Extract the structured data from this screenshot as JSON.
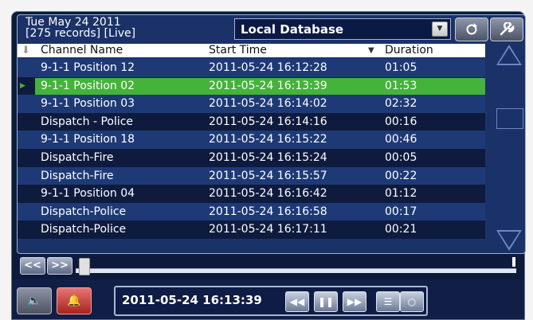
{
  "header": {
    "date": "Tue May 24 2011",
    "info": "[275 records]  [Live]"
  },
  "database": {
    "selected": "Local Database"
  },
  "toolbar": {
    "refresh_icon": "refresh-icon",
    "settings_icon": "wrench-icon"
  },
  "table": {
    "columns": [
      "Channel Name",
      "Start Time",
      "Duration"
    ],
    "rows": [
      {
        "channel": "9-1-1 Position 12",
        "start": "2011-05-24  16:12:28",
        "duration": "01:05"
      },
      {
        "channel": "9-1-1 Position 02",
        "start": "2011-05-24  16:13:39",
        "duration": "01:53"
      },
      {
        "channel": "9-1-1 Position 03",
        "start": "2011-05-24  16:14:02",
        "duration": "02:32"
      },
      {
        "channel": "Dispatch - Police",
        "start": "2011-05-24  16:14:16",
        "duration": "00:16"
      },
      {
        "channel": "9-1-1 Position 18",
        "start": "2011-05-24  16:15:22",
        "duration": "00:46"
      },
      {
        "channel": "Dispatch-Fire",
        "start": "2011-05-24  16:15:24",
        "duration": "00:05"
      },
      {
        "channel": "Dispatch-Fire",
        "start": "2011-05-24  16:15:57",
        "duration": "00:22"
      },
      {
        "channel": "9-1-1 Position 04",
        "start": "2011-05-24  16:16:42",
        "duration": "01:12"
      },
      {
        "channel": "Dispatch-Police",
        "start": "2011-05-24  16:16:58",
        "duration": "00:17"
      },
      {
        "channel": "Dispatch-Police",
        "start": "2011-05-24  16:17:11",
        "duration": "00:21"
      }
    ],
    "selected_index": 1
  },
  "timeline": {
    "rewind_label": "<<",
    "forward_label": ">>"
  },
  "playback": {
    "current_time": "2011-05-24  16:13:39"
  },
  "colors": {
    "selected_row": "#44b33a",
    "row_dark": "#0e1b3e",
    "row_light": "#1e3a76"
  }
}
